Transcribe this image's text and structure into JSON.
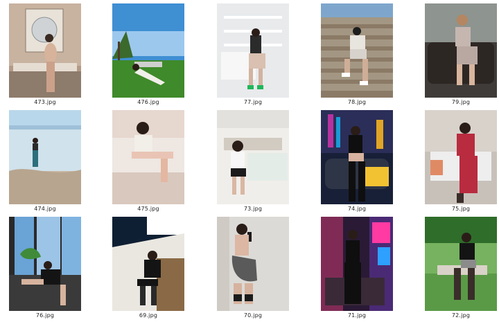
{
  "files": [
    {
      "name": "473.jpg",
      "scene": "gallery-wall"
    },
    {
      "name": "476.jpg",
      "scene": "garden-sky"
    },
    {
      "name": "77.jpg",
      "scene": "white-shelf"
    },
    {
      "name": "78.jpg",
      "scene": "stone-stairs"
    },
    {
      "name": "79.jpg",
      "scene": "leather-sofa"
    },
    {
      "name": "474.jpg",
      "scene": "beach"
    },
    {
      "name": "475.jpg",
      "scene": "studio-pink"
    },
    {
      "name": "73.jpg",
      "scene": "cafe"
    },
    {
      "name": "74.jpg",
      "scene": "neon-car"
    },
    {
      "name": "75.jpg",
      "scene": "red-dress-room"
    },
    {
      "name": "76.jpg",
      "scene": "balcony-window"
    },
    {
      "name": "69.jpg",
      "scene": "yacht"
    },
    {
      "name": "70.jpg",
      "scene": "mirror-selfie"
    },
    {
      "name": "71.jpg",
      "scene": "neon-night"
    },
    {
      "name": "72.jpg",
      "scene": "park-bench"
    }
  ]
}
